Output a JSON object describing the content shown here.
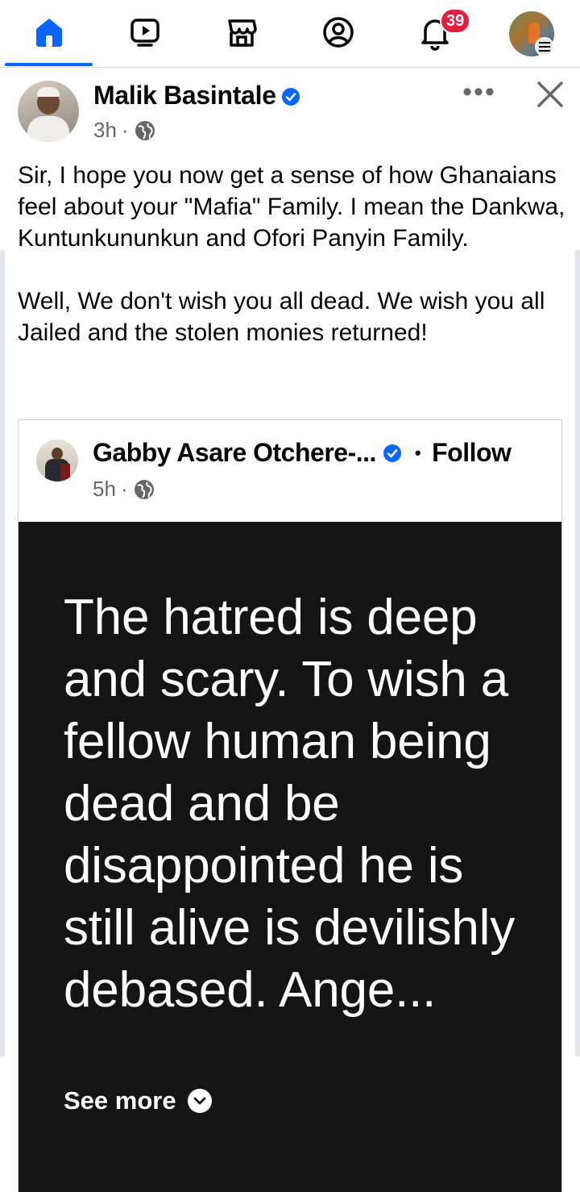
{
  "nav": {
    "items": [
      {
        "icon": "home-icon",
        "active": true
      },
      {
        "icon": "video-icon",
        "active": false
      },
      {
        "icon": "marketplace-icon",
        "active": false
      },
      {
        "icon": "profile-icon",
        "active": false
      },
      {
        "icon": "bell-icon",
        "active": false
      },
      {
        "icon": "profile-avatar",
        "active": false
      }
    ],
    "notification_count": "39",
    "accent_color": "#0866ff",
    "badge_color": "#e41e3f"
  },
  "post": {
    "author": "Malik Basintale",
    "time": "3h",
    "separator": "·",
    "more_label": "•••",
    "paragraphs": [
      "Sir, I hope you now get a sense of how Ghanaians feel about your \"Mafia\" Family. I mean the Dankwa, Kuntunkununkun and Ofori Panyin Family.",
      "Well, We don't wish you all dead. We wish you all Jailed and the stolen monies returned!"
    ]
  },
  "shared_post": {
    "author": "Gabby Asare Otchere-...",
    "dot": "•",
    "follow_label": "Follow",
    "time": "5h",
    "separator": "·",
    "text": "The hatred is deep and scary.  To wish a fellow human being dead and be disappointed he is still alive is devilishly debased. Ange...",
    "see_more_label": "See more",
    "background_color": "#141414"
  }
}
